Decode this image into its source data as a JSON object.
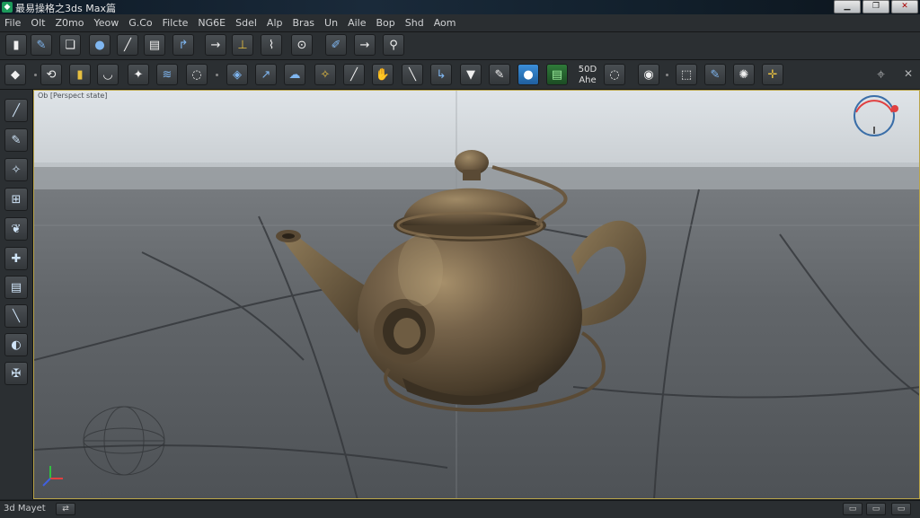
{
  "window": {
    "title": "最易操格之3ds Max篇",
    "minimize_glyph": "▁",
    "restore_glyph": "❐",
    "close_glyph": "✕"
  },
  "menu": [
    "File",
    "Olt",
    "Z0mo",
    "Yeow",
    "G.Co",
    "Filcte",
    "NG6E",
    "Sdel",
    "Alp",
    "Bras",
    "Un",
    "Aile",
    "Bop",
    "Shd",
    "Aom"
  ],
  "toolbar_top": {
    "icons": [
      "clipboard-icon",
      "wrench-icon",
      "copy-icon",
      "sphere-icon",
      "brush-icon",
      "save-icon",
      "pipe-icon",
      "arrow-right-icon",
      "move-vertical-icon",
      "link-icon",
      "next-icon",
      "paint-icon",
      "arrow-right-icon",
      "key-icon"
    ],
    "glyphs": [
      "▮",
      "✎",
      "❏",
      "●",
      "╱",
      "▤",
      "↱",
      "→",
      "⊥",
      "⌇",
      "⊙",
      "✐",
      "→",
      "⚲"
    ]
  },
  "toolbar_main": {
    "icons": [
      "navigate-icon",
      "rotate-view-icon",
      "box-icon",
      "teapot-icon",
      "feather-icon",
      "layers-icon",
      "loop-icon",
      "cube-select-icon",
      "wand-icon",
      "cloud-icon",
      "fish-icon",
      "pencil-icon",
      "hand-icon",
      "line-icon",
      "hook-icon",
      "cut-icon",
      "eraser-icon",
      "material-icon",
      "render-icon",
      "orbit-icon",
      "render-setup-icon",
      "frame-icon",
      "pen-tool-icon",
      "gear-icon",
      "move-icon"
    ],
    "glyphs": [
      "◆",
      "⟲",
      "▮",
      "◡",
      "✦",
      "≋",
      "◌",
      "◈",
      "↗",
      "☁",
      "✧",
      "╱",
      "✋",
      "╲",
      "↳",
      "▼",
      "✎",
      "●",
      "▤",
      "◌",
      "◉",
      "⬚",
      "✎",
      "✺",
      "✛"
    ],
    "label_line1": "50D",
    "label_line2": "Ahe",
    "label_tooltip": "Ahe"
  },
  "toolbar_right": {
    "target_glyph": "⌖",
    "close_glyph": "✕"
  },
  "left_tools": {
    "icons": [
      "line-tool-icon",
      "draw-tool-icon",
      "spray-icon",
      "stack-icon",
      "leaf-icon",
      "join-icon",
      "document-icon",
      "diagonal-icon",
      "shape-icon",
      "transform-icon"
    ],
    "glyphs": [
      "╱",
      "✎",
      "✧",
      "⊞",
      "❦",
      "✚",
      "▤",
      "╲",
      "◐",
      "✠"
    ]
  },
  "viewport": {
    "label": "Ob [Perspect state]",
    "colors": {
      "sky_top": "#dfe4e8",
      "sky_bottom": "#c7ccd0",
      "ground": "#5d6165",
      "teapot": "#6e5c42",
      "teapot_light": "#9c8664",
      "teapot_dark": "#3f3424"
    }
  },
  "status": {
    "text": "3d Mayet",
    "left_button": "⇄",
    "right_buttons": [
      "▭",
      "▭",
      "▭"
    ]
  }
}
